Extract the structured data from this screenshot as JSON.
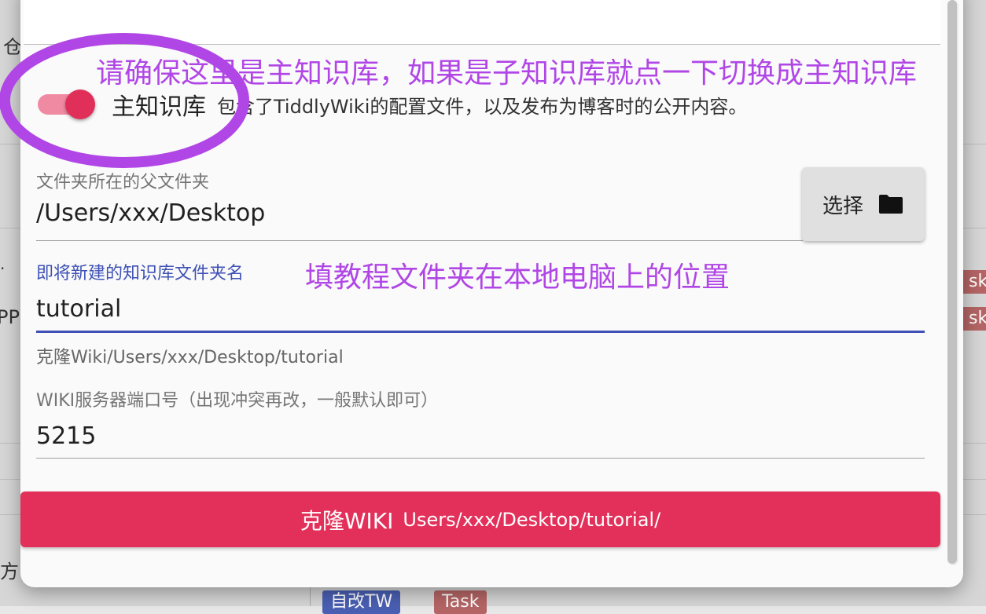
{
  "background": {
    "char_top": "仓",
    "char_bottom": "方",
    "char_mid_a": "·",
    "char_mid_b": "PP",
    "tags": [
      {
        "label": "sk",
        "color": "#b56565"
      },
      {
        "label": "sk",
        "color": "#b56565"
      },
      {
        "label": "自改TW",
        "color": "#4a5fb3"
      },
      {
        "label": "Task",
        "color": "#b56565"
      }
    ]
  },
  "toggle": {
    "label": "主知识库",
    "description": "包含了TiddlyWiki的配置文件，以及发布为博客时的公开内容。",
    "checked": true
  },
  "parent_folder": {
    "label": "文件夹所在的父文件夹",
    "value": "/Users/xxx/Desktop"
  },
  "choose_button": {
    "label": "选择",
    "icon": "folder-icon"
  },
  "new_folder": {
    "label": "即将新建的知识库文件夹名",
    "value": "tutorial",
    "helper": "克隆Wiki/Users/xxx/Desktop/tutorial"
  },
  "port": {
    "label": "WIKI服务器端口号（出现冲突再改，一般默认即可）",
    "value": "5215"
  },
  "clone_button": {
    "label": "克隆WIKI",
    "path": "Users/xxx/Desktop/tutorial/"
  },
  "annotations": {
    "top_note": "请确保这里是主知识库，如果是子知识库就点一下切换成主知识库",
    "middle_note": "填教程文件夹在本地电脑上的位置",
    "color": "#b146e6"
  },
  "colors": {
    "accent": "#e3305a",
    "focus": "#3f51b5"
  }
}
